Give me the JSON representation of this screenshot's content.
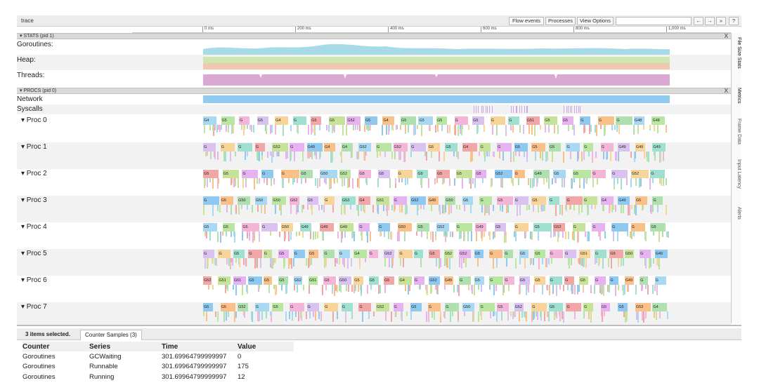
{
  "toolbar": {
    "title": "trace",
    "flow_events": "Flow events",
    "processes": "Processes",
    "view_options": "View Options",
    "nav_left": "←",
    "nav_right": "→",
    "nav_eq": "»",
    "help": "?"
  },
  "ruler": {
    "ticks": [
      "0 ms",
      "200 ms",
      "400 ms",
      "600 ms",
      "800 ms",
      "1,000 ms"
    ]
  },
  "stats_header": {
    "label": "▾ STATS (pid 1)",
    "close": "X"
  },
  "stats_rows": {
    "goroutines": "Goroutines:",
    "heap": "Heap:",
    "threads": "Threads:"
  },
  "procs_header": {
    "label": "▾ PROCS (pid 0)",
    "close": "X"
  },
  "procs_rows": {
    "network": "Network",
    "syscalls": "Syscalls"
  },
  "procs": [
    {
      "label": "Proc 0",
      "slices": [
        "G4",
        "G5",
        "G",
        "G5",
        "G4",
        "G",
        "G5",
        "G5",
        "G52",
        "G5",
        "G4",
        "G5",
        "G5",
        "G5",
        "G",
        "G5",
        "G",
        "G",
        "G51",
        "G5",
        "G5",
        "G",
        "G",
        "G",
        "G48",
        "G48"
      ]
    },
    {
      "label": "Proc 1",
      "slices": [
        "G",
        "G",
        "G",
        "G",
        "G52",
        "G",
        "G49",
        "G4",
        "G4",
        "G52",
        "G",
        "G52",
        "G",
        "G5",
        "G5",
        "G4",
        "G",
        "G",
        "G5",
        "G5",
        "G5",
        "G",
        "G",
        "G",
        "G49",
        "G49",
        "G49"
      ]
    },
    {
      "label": "Proc 2",
      "slices": [
        "G5",
        "G5",
        "G",
        "G",
        "G",
        "G5",
        "G50",
        "G52",
        "G5",
        "G5",
        "G",
        "G5",
        "G5",
        "G5",
        "G5",
        "G52",
        "G",
        "G49",
        "G5",
        "G5",
        "G",
        "G",
        "G52",
        "G"
      ]
    },
    {
      "label": "Proc 3",
      "slices": [
        "G",
        "G5",
        "G50",
        "G50",
        "G50",
        "G52",
        "G5",
        "G",
        "G53",
        "G4",
        "G51",
        "G",
        "G52",
        "G49",
        "G50",
        "G5",
        "G",
        "G5",
        "G",
        "G5",
        "G",
        "G",
        "G",
        "G4",
        "G49",
        "G5",
        "G"
      ]
    },
    {
      "label": "Proc 4",
      "slices": [
        "G5",
        "G5",
        "G5",
        "G",
        "G50",
        "G49",
        "G49",
        "G49",
        "G",
        "G",
        "G50",
        "G5",
        "G52",
        "G",
        "G49",
        "G5",
        "G",
        "G5",
        "G52",
        "G",
        "G",
        "G",
        "G",
        "G5"
      ]
    },
    {
      "label": "Proc 5",
      "slices": [
        "G",
        "G",
        "G5",
        "G",
        "G",
        "G5",
        "G",
        "G5",
        "G",
        "G",
        "G4",
        "G",
        "G52",
        "G",
        "G",
        "G5",
        "G52",
        "G52",
        "G5",
        "G",
        "G",
        "G5",
        "G5",
        "G",
        "G",
        "G51",
        "G",
        "G5",
        "G50",
        "G",
        "G49"
      ]
    },
    {
      "label": "Proc 6",
      "slices": [
        "G52",
        "G51",
        "G51",
        "G5",
        "G5",
        "G5",
        "G52",
        "G51",
        "G5",
        "G50",
        "G5",
        "G5",
        "G5",
        "G4",
        "G",
        "G52",
        "G49",
        "G",
        "G5",
        "G",
        "G",
        "G5",
        "G5",
        "G",
        "G",
        "G5",
        "G",
        "G",
        "G49",
        "G",
        "G"
      ]
    },
    {
      "label": "Proc 7",
      "slices": [
        "G5",
        "G5",
        "G52",
        "G",
        "G5",
        "G",
        "G",
        "G",
        "G",
        "G",
        "G52",
        "G",
        "G5",
        "G",
        "G",
        "G50",
        "G",
        "G5",
        "G52",
        "G",
        "G5",
        "G",
        "G",
        "G5",
        "G5",
        "G53",
        "G4"
      ]
    }
  ],
  "sidebar_tabs": [
    "File Size Stats",
    "Metrics",
    "Frame Data",
    "Input Latency",
    "Alerts"
  ],
  "bottom": {
    "selection": "3 items selected.",
    "tab": "Counter Samples (3)",
    "columns": [
      "Counter",
      "Series",
      "Time",
      "Value"
    ],
    "rows": [
      [
        "Goroutines",
        "GCWaiting",
        "301.69964799999997",
        "0"
      ],
      [
        "Goroutines",
        "Runnable",
        "301.69964799999997",
        "175"
      ],
      [
        "Goroutines",
        "Running",
        "301.69964799999997",
        "12"
      ]
    ]
  },
  "colors": {
    "goroutines_fill": "#a8dbe8",
    "heap_fill_1": "#cfe6b0",
    "heap_fill_2": "#f0c8ad",
    "threads_fill": "#d9a9d4",
    "network": "#7cc2f0",
    "syscalls": "#c9a6e0"
  }
}
